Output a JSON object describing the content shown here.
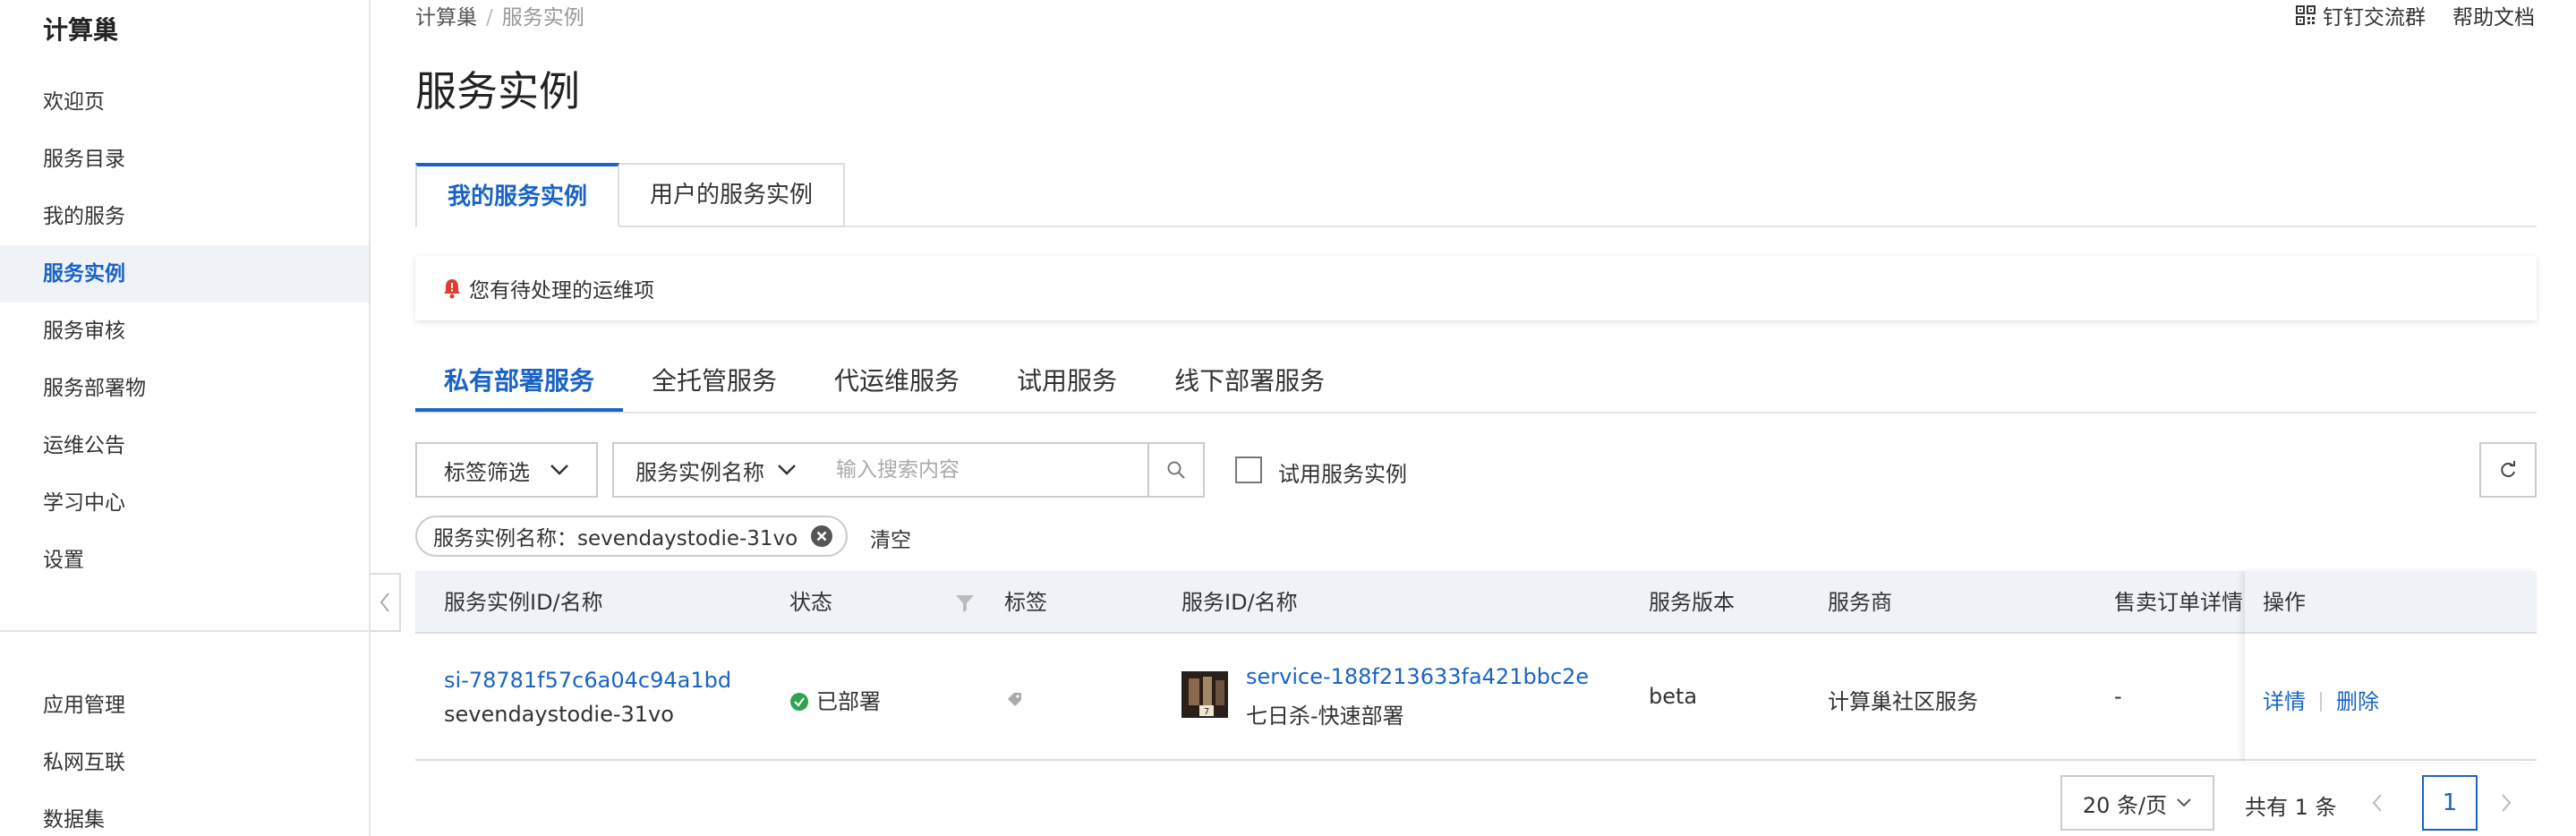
{
  "sidebar": {
    "title": "计算巢",
    "items": [
      {
        "label": "欢迎页"
      },
      {
        "label": "服务目录"
      },
      {
        "label": "我的服务"
      },
      {
        "label": "服务实例"
      },
      {
        "label": "服务审核"
      },
      {
        "label": "服务部署物"
      },
      {
        "label": "运维公告"
      },
      {
        "label": "学习中心"
      },
      {
        "label": "设置"
      }
    ],
    "bottom_items": [
      {
        "label": "应用管理"
      },
      {
        "label": "私网互联"
      },
      {
        "label": "数据集"
      }
    ],
    "active_index": 3
  },
  "header": {
    "breadcrumb": [
      "计算巢",
      "服务实例"
    ],
    "links": [
      "钉钉交流群",
      "帮助文档"
    ],
    "title": "服务实例"
  },
  "top_tabs": [
    "我的服务实例",
    "用户的服务实例"
  ],
  "alert": {
    "text": "您有待处理的运维项"
  },
  "sub_tabs": [
    "私有部署服务",
    "全托管服务",
    "代运维服务",
    "试用服务",
    "线下部署服务"
  ],
  "filters": {
    "tag_filter_label": "标签筛选",
    "field_select_label": "服务实例名称",
    "search_placeholder": "输入搜索内容",
    "trial_checkbox_label": "试用服务实例",
    "trial_checked": false
  },
  "active_filter": {
    "chip_text": "服务实例名称：sevendaystodie-31vo",
    "clear_label": "清空"
  },
  "table": {
    "columns": [
      "服务实例ID/名称",
      "状态",
      "标签",
      "服务ID/名称",
      "服务版本",
      "服务商",
      "售卖订单详情",
      "操作"
    ],
    "rows": [
      {
        "instance_id": "si-78781f57c6a04c94a1bd",
        "instance_name": "sevendaystodie-31vo",
        "status": "已部署",
        "service_id": "service-188f213633fa421bbc2e",
        "service_name": "七日杀-快速部署",
        "version": "beta",
        "provider": "计算巢社区服务",
        "order_detail": "-",
        "actions": [
          "详情",
          "删除"
        ]
      }
    ]
  },
  "pagination": {
    "page_size_label": "20 条/页",
    "total_label": "共有 1 条",
    "current_page": "1"
  },
  "colors": {
    "primary": "#1a63c6",
    "success": "#2ea44f",
    "alert_icon": "#e03e2d",
    "header_bg": "#eff3f8"
  }
}
